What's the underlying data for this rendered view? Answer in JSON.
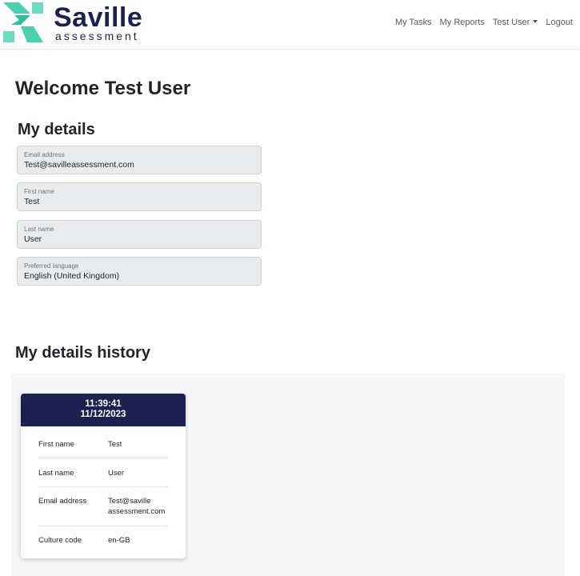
{
  "brand": {
    "name": "Saville",
    "tagline": "assessment",
    "colors": {
      "navy": "#1b2252",
      "teal": "#4dd0b0"
    }
  },
  "nav": {
    "my_tasks": "My Tasks",
    "my_reports": "My Reports",
    "user_menu": "Test User",
    "logout": "Logout"
  },
  "welcome": "Welcome Test User",
  "details": {
    "heading": "My details",
    "email": {
      "label": "Email address",
      "value": "Test@savilleassessment.com"
    },
    "first_name": {
      "label": "First name",
      "value": "Test"
    },
    "last_name": {
      "label": "Last name",
      "value": "User"
    },
    "language": {
      "label": "Preferred language",
      "value": "English (United Kingdom)"
    }
  },
  "history": {
    "heading": "My details history",
    "entries": [
      {
        "time": "11:39:41",
        "date": "11/12/2023",
        "rows": [
          {
            "key": "First name",
            "value": "Test"
          },
          {
            "key": "Last name",
            "value": "User"
          },
          {
            "key": "Email address",
            "value": "Test@saville assessment.com"
          },
          {
            "key": "Culture code",
            "value": "en-GB"
          }
        ]
      }
    ]
  }
}
